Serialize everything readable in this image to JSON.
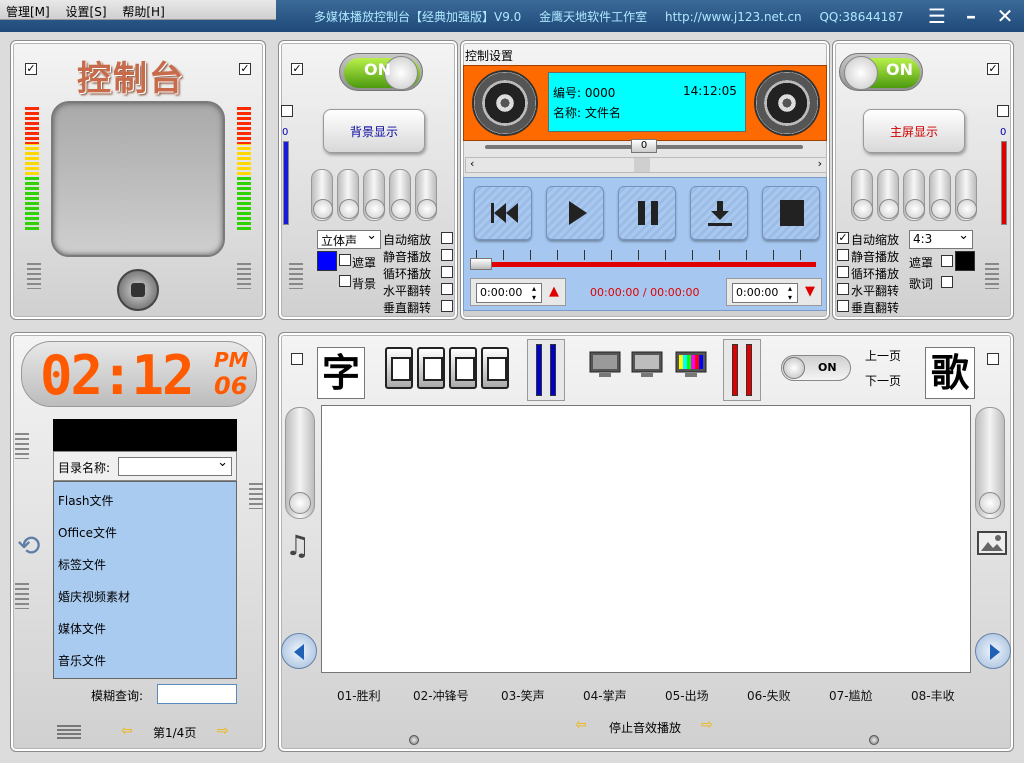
{
  "menu": {
    "manage": "管理[M]",
    "settings": "设置[S]",
    "help": "帮助[H]"
  },
  "title": {
    "app": "多媒体播放控制台【经典加强版】V9.0",
    "studio": "金鹰天地软件工作室",
    "url": "http://www.j123.net.cn",
    "qq": "QQ:38644187"
  },
  "left_top": {
    "heading": "控制台"
  },
  "clock": {
    "time": "02:12",
    "ampm": "PM",
    "seconds": "06"
  },
  "directory": {
    "label": "目录名称:",
    "items": [
      "Flash文件",
      "Office文件",
      "标签文件",
      "婚庆视频素材",
      "媒体文件",
      "音乐文件"
    ],
    "search_label": "模糊查询:",
    "page": "第1/4页"
  },
  "left_control": {
    "switch": "ON",
    "display_button": "背景显示",
    "level": "0",
    "audio_mode": "立体声",
    "mask": "遮罩",
    "background": "背景",
    "options": [
      "自动缩放",
      "静音播放",
      "循环播放",
      "水平翻转",
      "垂直翻转"
    ]
  },
  "center": {
    "heading": "控制设置",
    "number_label": "编号:",
    "number": "0000",
    "time": "14:12:05",
    "name_label": "名称:",
    "name": "文件名",
    "position": "0",
    "start_time": "0:00:00",
    "end_time": "0:00:00",
    "progress": "00:00:00 / 00:00:00",
    "progress_value": 0
  },
  "right_control": {
    "switch": "ON",
    "display_button": "主屏显示",
    "level": "0",
    "aspect": "4:3",
    "mask": "遮罩",
    "lyrics": "歌词",
    "options": [
      "自动缩放",
      "静音播放",
      "循环播放",
      "水平翻转",
      "垂直翻转"
    ]
  },
  "bottom": {
    "char_left": "字",
    "char_right": "歌",
    "switch": "ON",
    "prev_page": "上一页",
    "next_page": "下一页",
    "effects": [
      "01-胜利",
      "02-冲锋号",
      "03-笑声",
      "04-掌声",
      "05-出场",
      "06-失败",
      "07-尴尬",
      "08-丰收"
    ],
    "stop_effect": "停止音效播放"
  },
  "colors": {
    "accent": "#1f4a79",
    "cyan": "#00ffff",
    "orange": "#ff6a00",
    "list_bg": "#a9cbf0",
    "red": "#e00000"
  }
}
